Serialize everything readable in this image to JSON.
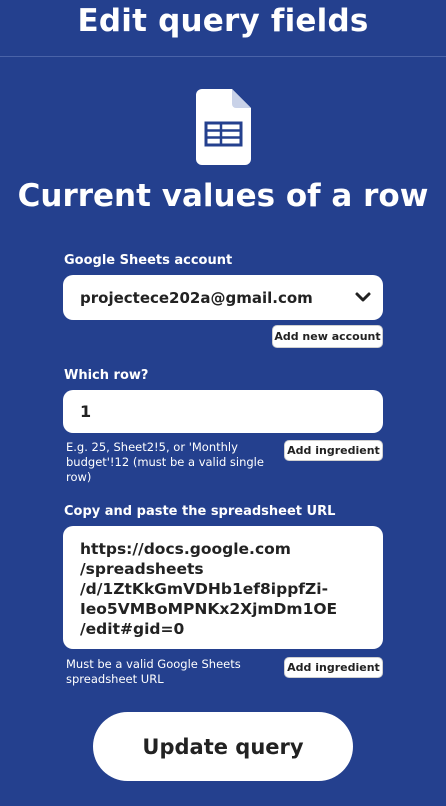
{
  "header": {
    "title": "Edit query fields"
  },
  "service": {
    "icon": "google-sheets-icon",
    "applet_title": "Current values of a row"
  },
  "account": {
    "label": "Google Sheets account",
    "selected": "projectece202a@gmail.com",
    "add_button": "Add new account"
  },
  "row": {
    "label": "Which row?",
    "value": "1",
    "help": [
      "E.g. 25, Sheet2!5, or 'Monthly",
      "budget'!12 (must be a valid single",
      "row)"
    ],
    "add_button": "Add ingredient"
  },
  "url": {
    "label": "Copy and paste the spreadsheet URL",
    "value_lines": [
      "https://docs.google.com",
      "/spreadsheets",
      "/d/1ZtKkGmVDHb1ef8ippfZi-",
      "Ieo5VMBoMPNKx2XjmDm1OE",
      "/edit#gid=0"
    ],
    "help": [
      "Must be a valid Google Sheets",
      "spreadsheet URL"
    ],
    "add_button": "Add ingredient"
  },
  "submit": {
    "label": "Update query"
  },
  "colors": {
    "background": "#24408e",
    "surface": "#ffffff",
    "text_dark": "#222222"
  }
}
